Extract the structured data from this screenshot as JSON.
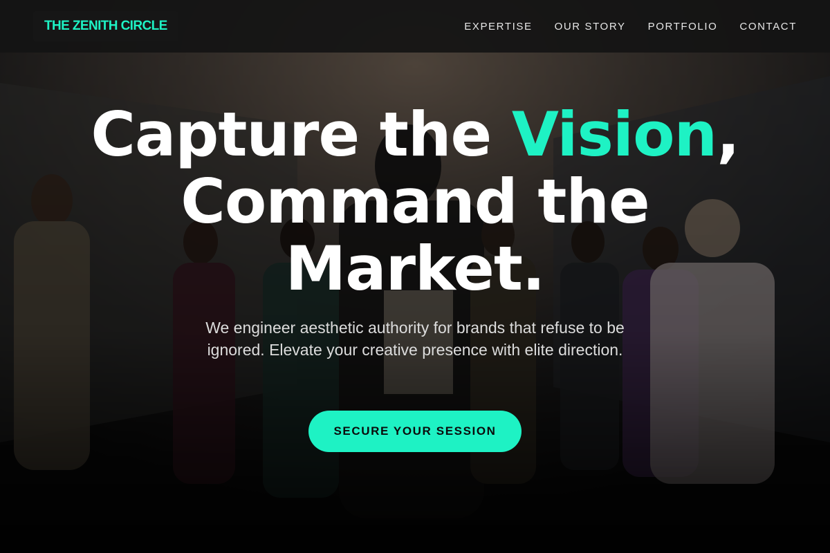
{
  "header": {
    "logo": "THE ZENITH CIRCLE",
    "nav": [
      {
        "label": "EXPERTISE"
      },
      {
        "label": "OUR STORY"
      },
      {
        "label": "PORTFOLIO"
      },
      {
        "label": "CONTACT"
      }
    ]
  },
  "hero": {
    "headline_part1": "Capture the ",
    "headline_accent": "Vision",
    "headline_part2": ",",
    "headline_line2": "Command the",
    "headline_line3": "Market.",
    "subtitle": "We engineer aesthetic authority for brands that refuse to be ignored. Elevate your creative presence with elite direction.",
    "cta_label": "SECURE YOUR SESSION",
    "background_description_icon": "fashion-crowd-photo"
  },
  "colors": {
    "accent": "#1ef2c4",
    "header_bg": "#141414",
    "text": "#ffffff"
  }
}
